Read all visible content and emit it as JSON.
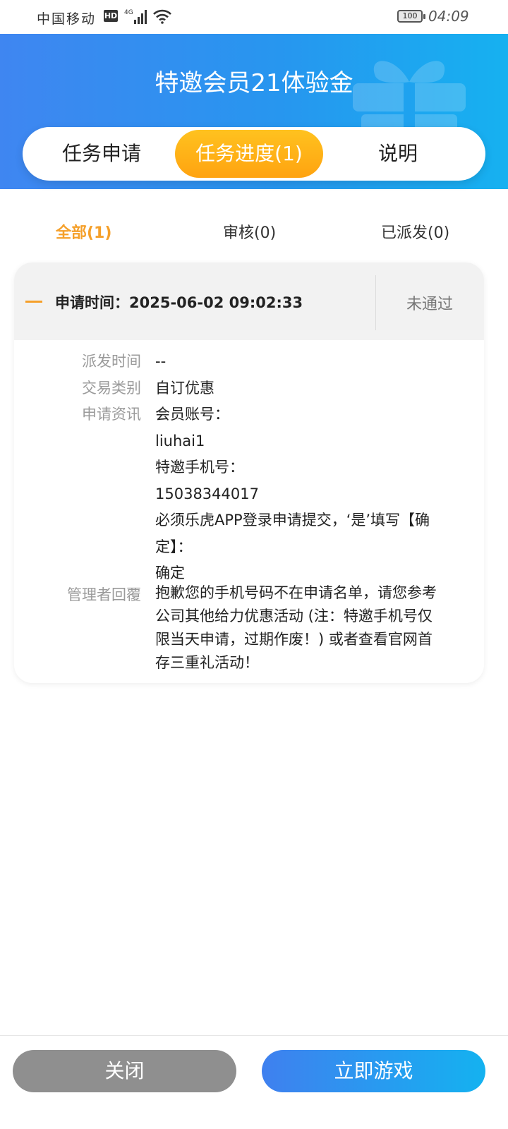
{
  "status_bar": {
    "carrier": "中国移动",
    "hd": "HD",
    "network": "4G",
    "battery": "100",
    "time": "04:09"
  },
  "header": {
    "title": "特邀会员21体验金"
  },
  "tabs": [
    {
      "label": "任务申请",
      "active": false
    },
    {
      "label": "任务进度(1)",
      "active": true
    },
    {
      "label": "说明",
      "active": false
    }
  ],
  "filters": [
    {
      "label": "全部(1)",
      "active": true
    },
    {
      "label": "审核(0)",
      "active": false
    },
    {
      "label": "已派发(0)",
      "active": false
    }
  ],
  "record": {
    "apply_time": "申请时间：2025-06-02 09:02:33",
    "status": "未通过",
    "dispatch_time_label": "派发时间",
    "dispatch_time_value": "--",
    "type_label": "交易类别",
    "type_value": "自订优惠",
    "info_label": "申请资讯",
    "info_lines": [
      "会员账号：",
      "liuhai1",
      "特邀手机号：",
      "15038344017",
      "必须乐虎APP登录申请提交，‘是’填写【确",
      "定】：",
      "确定"
    ],
    "reply_label": "管理者回覆",
    "reply_lines": [
      "抱歉您的手机号码不在申请名单，请您参考",
      "公司其他给力优惠活动 (注：特邀手机号仅",
      "限当天申请，过期作废！) 或者查看官网首",
      "存三重礼活动！"
    ]
  },
  "buttons": {
    "close": "关闭",
    "play": "立即游戏"
  },
  "colors": {
    "header_start": "#3f86f1",
    "header_end": "#16b1f0",
    "accent_orange": "#f5a02a",
    "tab_active_start": "#ffc21f",
    "tab_active_end": "#ffa310",
    "close_button": "#8f8f8f"
  }
}
